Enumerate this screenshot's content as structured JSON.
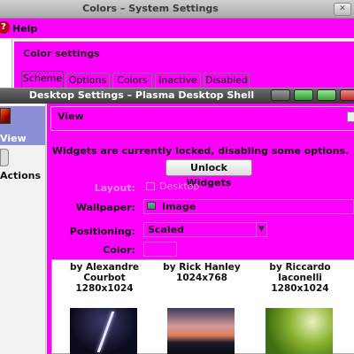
{
  "back_window": {
    "title": "Colors – System Settings",
    "menu": {
      "help": "Help"
    },
    "header_title": "Color settings",
    "tabs": [
      {
        "label": "Scheme",
        "active": true
      },
      {
        "label": "Options",
        "active": false
      },
      {
        "label": "Colors",
        "active": false
      },
      {
        "label": "Inactive",
        "active": false
      },
      {
        "label": "Disabled",
        "active": false
      }
    ]
  },
  "front_window": {
    "title": "Desktop Settings – Plasma Desktop Shell",
    "sidebar": {
      "items": [
        {
          "label": "View",
          "selected": true
        },
        {
          "label": "Actions",
          "selected": false
        }
      ]
    },
    "section_title": "View",
    "lock_message": "Widgets are currently locked, disabling some options.",
    "unlock_button": "Unlock Widgets",
    "form": {
      "layout_label": "Layout:",
      "layout_value": "Desktop",
      "wallpaper_label": "Wallpaper:",
      "wallpaper_value": "Image",
      "positioning_label": "Positioning:",
      "positioning_value": "Scaled",
      "color_label": "Color:",
      "color_value": "#ff00ff"
    },
    "wallpapers": [
      {
        "author_line1": "by Alexandre",
        "author_line2": "Courbot",
        "size": "1280x1024"
      },
      {
        "author_line1": "by Rick Hanley",
        "author_line2": "",
        "size": "1024x768"
      },
      {
        "author_line1": "by Riccardo",
        "author_line2": "Iaconelli",
        "size": "1280x1024"
      }
    ]
  },
  "colors": {
    "accent": "#ff00ff",
    "selection": "#8d8fd6"
  }
}
